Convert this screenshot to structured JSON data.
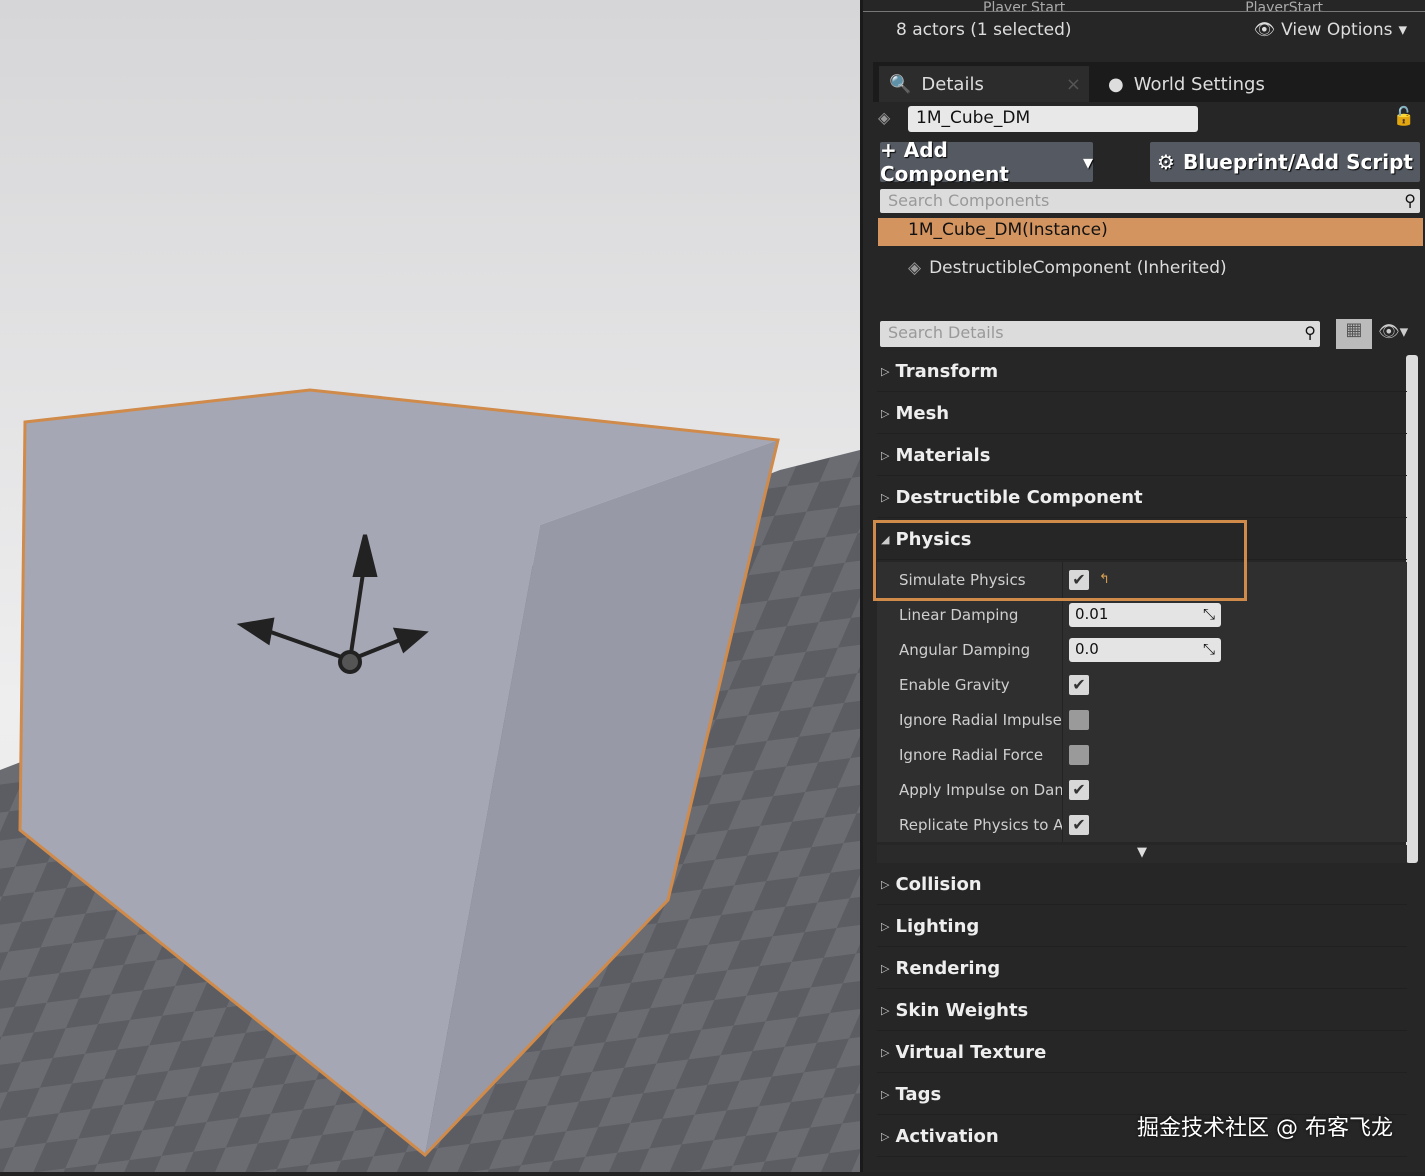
{
  "outliner": {
    "partial_row_label": "Player Start",
    "partial_row_type": "PlayerStart",
    "actor_count": "8 actors (1 selected)",
    "view_options": "View Options"
  },
  "tabs": [
    {
      "label": "Details",
      "icon": "details-icon",
      "active": true
    },
    {
      "label": "World Settings",
      "icon": "globe-icon"
    }
  ],
  "details": {
    "actor_name": "1M_Cube_DM",
    "add_component": "+ Add Component",
    "blueprint": "Blueprint/Add Script",
    "search_components_placeholder": "Search Components",
    "components": [
      {
        "label": "1M_Cube_DM(Instance)",
        "selected": true
      },
      {
        "label": "DestructibleComponent (Inherited)"
      }
    ],
    "search_details_placeholder": "Search Details",
    "sections_before": [
      "Transform",
      "Mesh",
      "Materials",
      "Destructible Component"
    ],
    "physics": {
      "label": "Physics",
      "expanded": true,
      "rows": [
        {
          "label": "Simulate Physics",
          "type": "check",
          "value": true
        },
        {
          "label": "Linear Damping",
          "type": "number",
          "value": "0.01"
        },
        {
          "label": "Angular Damping",
          "type": "number",
          "value": "0.0"
        },
        {
          "label": "Enable Gravity",
          "type": "check",
          "value": true
        },
        {
          "label": "Ignore Radial Impulse",
          "type": "check",
          "value": false
        },
        {
          "label": "Ignore Radial Force",
          "type": "check",
          "value": false
        },
        {
          "label": "Apply Impulse on Dam",
          "type": "check",
          "value": true
        },
        {
          "label": "Replicate Physics to A",
          "type": "check",
          "value": true
        }
      ]
    },
    "sections_after": [
      "Collision",
      "Lighting",
      "Rendering",
      "Skin Weights",
      "Virtual Texture",
      "Tags",
      "Activation"
    ]
  },
  "colors": {
    "selection_orange": "#d4945f",
    "highlight_box": "#d08a4a"
  },
  "watermark": "掘金技术社区 @ 布客飞龙"
}
